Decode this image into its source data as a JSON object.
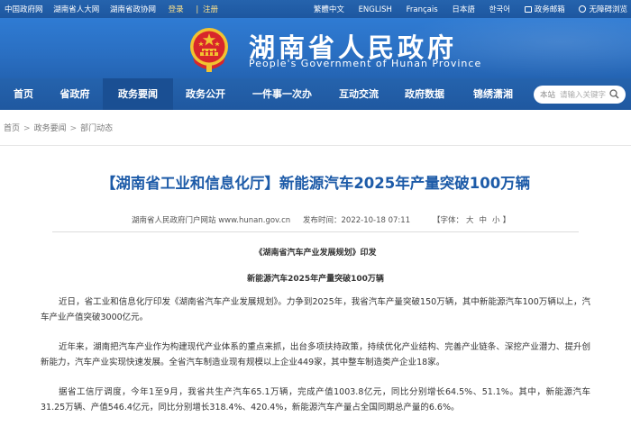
{
  "topbar": {
    "links": [
      "中国政府网",
      "湖南省人大网",
      "湖南省政协网"
    ],
    "login": "登录",
    "divider": "|",
    "register": "注册",
    "right": {
      "lang_cn_trad": "繁體中文",
      "lang_en": "ENGLISH",
      "lang_fr": "Français",
      "lang_ja": "日本語",
      "lang_ko": "한국어",
      "mail": "政务邮箱",
      "accessibility": "无障碍浏览"
    }
  },
  "header": {
    "title": "湖南省人民政府",
    "subtitle": "People's Government of Hunan Province"
  },
  "nav": {
    "items": [
      "首页",
      "省政府",
      "政务要闻",
      "政务公开",
      "一件事一次办",
      "互动交流",
      "政府数据",
      "锦绣潇湘"
    ],
    "active_index": 2,
    "search_scope": "本站",
    "search_placeholder": "请输入关键字"
  },
  "breadcrumb": [
    "首页",
    "政务要闻",
    "部门动态"
  ],
  "article": {
    "title": "【湖南省工业和信息化厅】新能源汽车2025年产量突破100万辆",
    "source": "湖南省人民政府门户网站 www.hunan.gov.cn",
    "date_label": "发布时间：",
    "date": "2022-10-18 07:11",
    "font_label": "【字体：",
    "font_large": "大",
    "font_medium": "中",
    "font_small": "小",
    "font_close": "】",
    "subhead1": "《湖南省汽车产业发展规划》印发",
    "subhead2": "新能源汽车2025年产量突破100万辆",
    "paragraphs": [
      "近日，省工业和信息化厅印发《湖南省汽车产业发展规划》。力争到2025年，我省汽车产量突破150万辆，其中新能源汽车100万辆以上，汽车产业产值突破3000亿元。",
      "近年来，湖南把汽车产业作为构建现代产业体系的重点来抓，出台多项扶持政策，持续优化产业结构、完善产业链条、深挖产业潜力、提升创新能力，汽车产业实现快速发展。全省汽车制造业现有规模以上企业449家，其中整车制造类产企业18家。",
      "据省工信厅调度，今年1至9月，我省共生产汽车65.1万辆，完成产值1003.8亿元，同比分别增长64.5%、51.1%。其中，新能源汽车31.25万辆、产值546.4亿元，同比分别增长318.4%、420.4%，新能源汽车产量占全国同期总产量的6.6%。"
    ]
  },
  "colors": {
    "brand_blue": "#2563ad",
    "title_blue": "#1d5ba8",
    "emblem_red": "#d8262b",
    "emblem_gold": "#f2c330"
  }
}
